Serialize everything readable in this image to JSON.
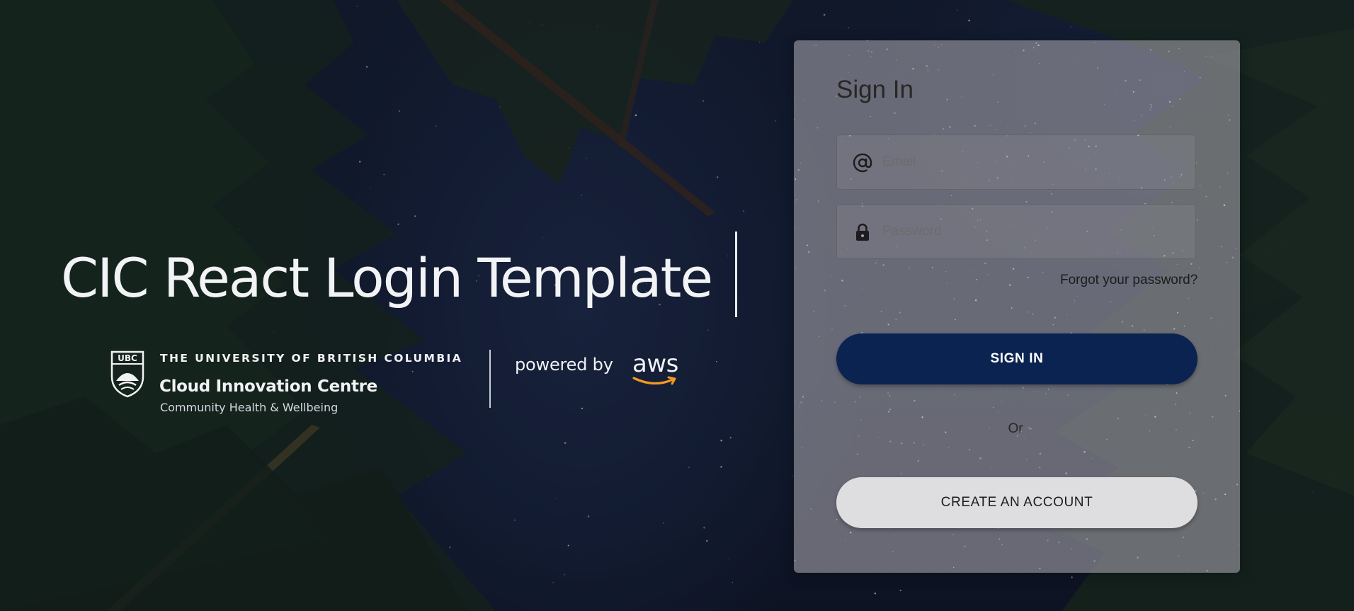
{
  "hero": {
    "title": "CIC React Login Template"
  },
  "branding": {
    "university": "THE UNIVERSITY OF BRITISH COLUMBIA",
    "centre": "Cloud Innovation Centre",
    "subtitle": "Community Health & Wellbeing",
    "powered_by": "powered by",
    "aws": "aws",
    "crest_initials": "UBC"
  },
  "signin": {
    "title": "Sign In",
    "email_placeholder": "Email",
    "password_placeholder": "Password",
    "forgot_password": "Forgot your password?",
    "signin_button": "SIGN IN",
    "or": "Or",
    "create_account_button": "CREATE AN ACCOUNT"
  },
  "icons": {
    "email": "at-sign-icon",
    "password": "lock-icon",
    "crest": "ubc-crest-icon",
    "aws_smile": "aws-smile-icon"
  },
  "colors": {
    "primary_button": "#0b2350",
    "secondary_button": "#dedddf",
    "aws_orange": "#f29a22",
    "card_background": "rgba(160,158,166,0.62)"
  }
}
